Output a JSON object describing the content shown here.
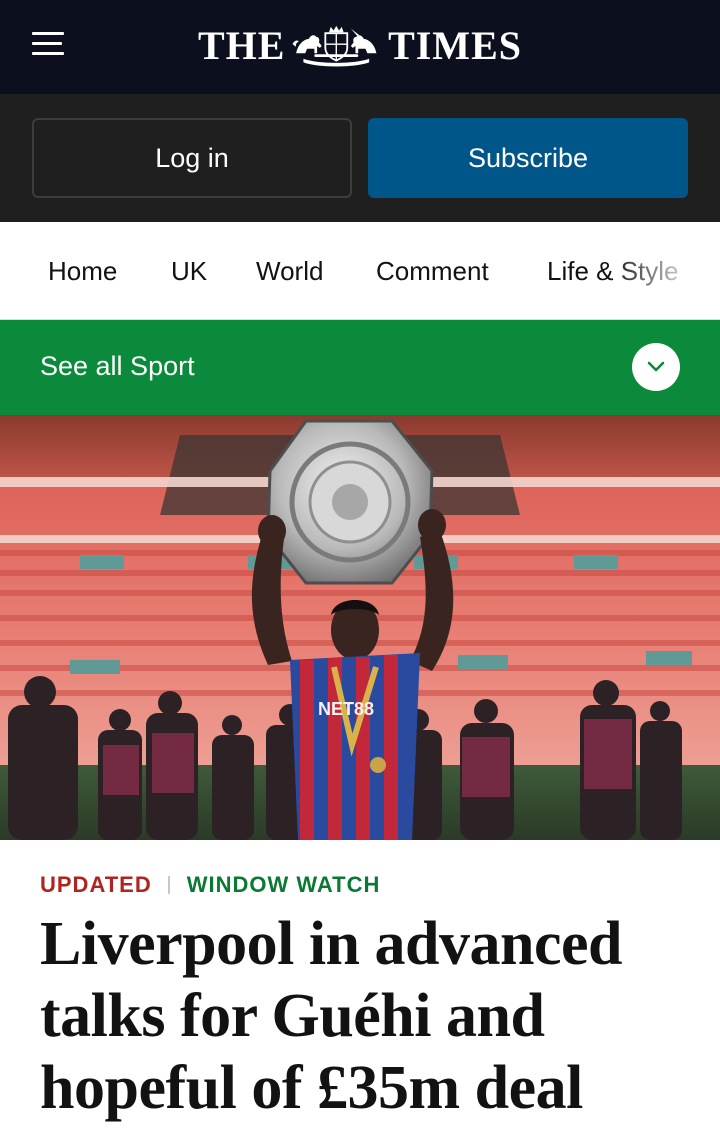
{
  "masthead": {
    "logo_left": "THE",
    "logo_right": "TIMES",
    "menu_icon": "hamburger-menu-icon",
    "crest_icon": "royal-crest-icon",
    "background": "#0b0f1e"
  },
  "account": {
    "login_label": "Log in",
    "subscribe_label": "Subscribe",
    "subscribe_color": "#005689"
  },
  "nav": {
    "items": [
      "Home",
      "UK",
      "World",
      "Comment",
      "Life & Style"
    ]
  },
  "sport": {
    "label": "See all Sport",
    "toggle_icon": "chevron-down-icon",
    "color": "#0a8a3a"
  },
  "hero": {
    "image": "Footballer in red and blue striped kit holding the Community Shield trophy above his head in a stadium",
    "shirt_sponsor": "NET88"
  },
  "article": {
    "kicker_status": "UPDATED",
    "kicker_section": "WINDOW WATCH",
    "headline": "Liverpool in advanced talks for Guéhi and hopeful of £35m deal",
    "status_color": "#b0231f",
    "section_color": "#0a7a33"
  }
}
